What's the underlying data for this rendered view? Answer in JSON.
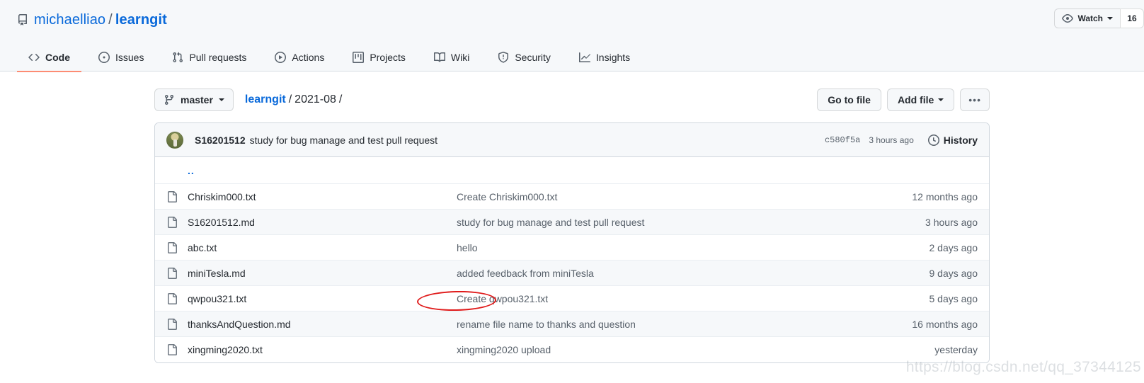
{
  "header": {
    "repo_icon": "repo-icon",
    "owner": "michaelliao",
    "separator": "/",
    "repo": "learngit",
    "watch_label": "Watch",
    "watch_icon": "eye-icon",
    "watch_count": "16"
  },
  "nav": {
    "items": [
      {
        "label": "Code",
        "icon": "code-icon",
        "active": true
      },
      {
        "label": "Issues",
        "icon": "issue-opened-icon",
        "active": false
      },
      {
        "label": "Pull requests",
        "icon": "git-pull-request-icon",
        "active": false
      },
      {
        "label": "Actions",
        "icon": "play-icon",
        "active": false
      },
      {
        "label": "Projects",
        "icon": "project-icon",
        "active": false
      },
      {
        "label": "Wiki",
        "icon": "book-icon",
        "active": false
      },
      {
        "label": "Security",
        "icon": "shield-icon",
        "active": false
      },
      {
        "label": "Insights",
        "icon": "graph-icon",
        "active": false
      }
    ]
  },
  "file_nav": {
    "branch_icon": "git-branch-icon",
    "branch_name": "master",
    "breadcrumb": {
      "root": "learngit",
      "sep1": "/",
      "folder": "2021-08",
      "sep2": "/"
    },
    "go_to_file_label": "Go to file",
    "add_file_label": "Add file",
    "kebab_label": "•••"
  },
  "commit_bar": {
    "avatar": "avatar",
    "author": "S16201512",
    "message": "study for bug manage and test pull request",
    "sha": "c580f5a",
    "time": "3 hours ago",
    "history_label": "History",
    "history_icon": "clock-icon"
  },
  "file_table": {
    "parent_dir": "..",
    "rows": [
      {
        "name": "Chriskim000.txt",
        "icon": "file-icon",
        "message": "Create Chriskim000.txt",
        "time": "12 months ago",
        "annotated": false
      },
      {
        "name": "S16201512.md",
        "icon": "file-icon",
        "message": "study for bug manage and test pull request",
        "time": "3 hours ago",
        "annotated": true
      },
      {
        "name": "abc.txt",
        "icon": "file-icon",
        "message": "hello",
        "time": "2 days ago",
        "annotated": false
      },
      {
        "name": "miniTesla.md",
        "icon": "file-icon",
        "message": "added feedback from miniTesla",
        "time": "9 days ago",
        "annotated": false
      },
      {
        "name": "qwpou321.txt",
        "icon": "file-icon",
        "message": "Create qwpou321.txt",
        "time": "5 days ago",
        "annotated": false
      },
      {
        "name": "thanksAndQuestion.md",
        "icon": "file-icon",
        "message": "rename file name to thanks and question",
        "time": "16 months ago",
        "annotated": false
      },
      {
        "name": "xingming2020.txt",
        "icon": "file-icon",
        "message": "xingming2020 upload",
        "time": "yesterday",
        "annotated": false
      }
    ]
  },
  "watermark": "https://blog.csdn.net/qq_37344125",
  "colors": {
    "accent_link": "#0969da",
    "active_tab_underline": "#fd8c73",
    "header_bg": "#f6f8fa",
    "border": "#d0d7de",
    "annotation_red": "#e01b1b"
  }
}
